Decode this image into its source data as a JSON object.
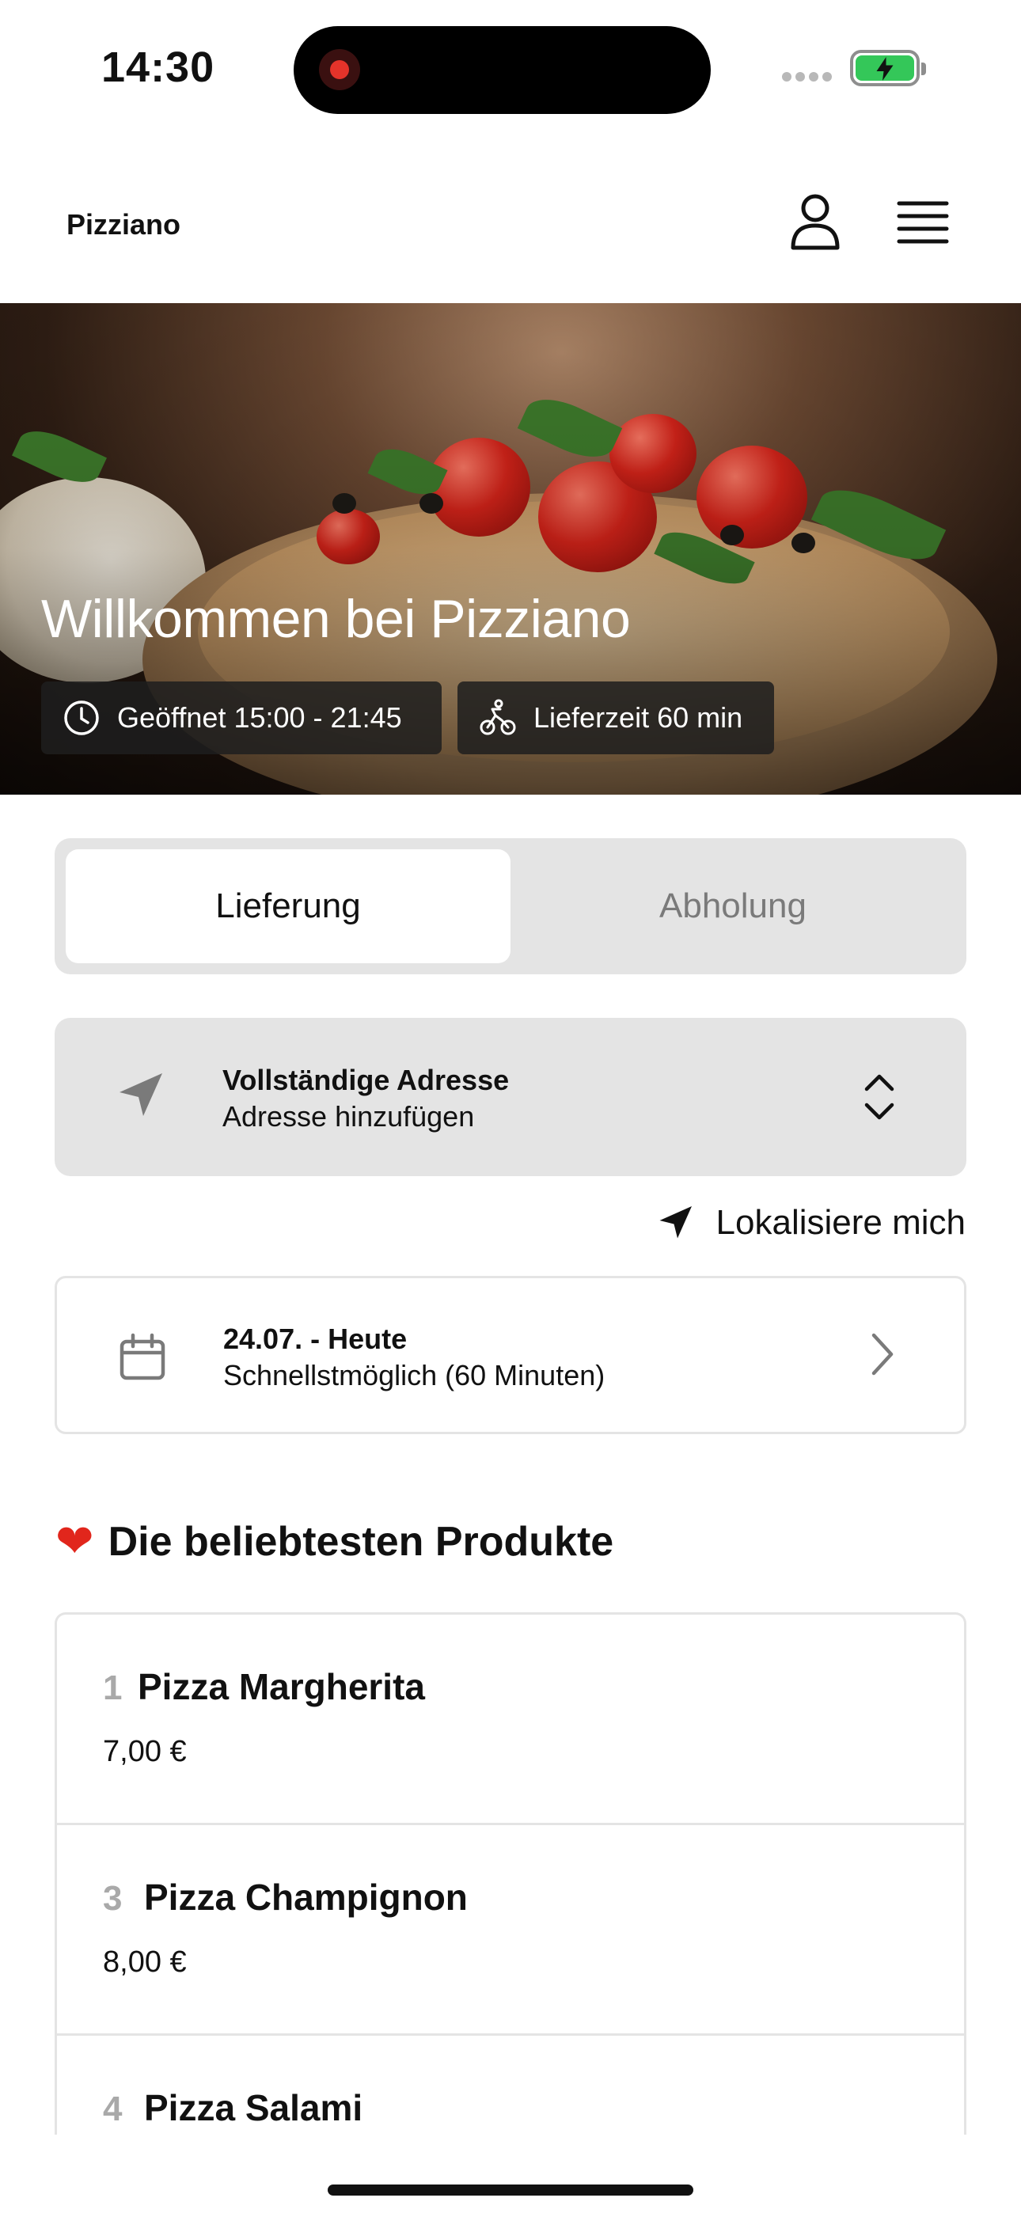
{
  "status_bar": {
    "time": "14:30"
  },
  "header": {
    "brand": "Pizziano",
    "icons": [
      "user-icon",
      "menu-icon"
    ]
  },
  "hero": {
    "title": "Willkommen bei Pizziano",
    "opening_hours": "Geöffnet 15:00 - 21:45",
    "delivery_time": "Lieferzeit 60 min"
  },
  "order_mode": {
    "options": [
      "Lieferung",
      "Abholung"
    ],
    "selected": "Lieferung"
  },
  "address": {
    "title": "Vollständige Adresse",
    "subtitle": "Adresse hinzufügen"
  },
  "locate_me": "Lokalisiere mich",
  "schedule": {
    "title": "24.07. - Heute",
    "subtitle": "Schnellstmöglich (60 Minuten)"
  },
  "popular": {
    "heading": "Die beliebtesten Produkte",
    "items": [
      {
        "rank": "1",
        "name": "Pizza Margherita",
        "price": "7,00 €"
      },
      {
        "rank": "3",
        "name": "Pizza Champignon",
        "price": "8,00 €"
      },
      {
        "rank": "4",
        "name": "Pizza Salami",
        "price": ""
      }
    ]
  },
  "colors": {
    "accent": "#e1261c",
    "battery": "#34c759",
    "panel": "#e4e4e4"
  }
}
